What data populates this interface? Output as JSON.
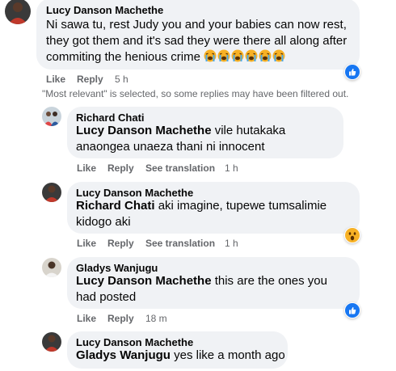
{
  "colors": {
    "bubble": "#f0f2f5",
    "meta_text": "#65676b",
    "like_blue": "#1877f2",
    "wow_yellow": "#f7b125"
  },
  "comments": [
    {
      "author": "Lucy Danson Machethe",
      "text": "Ni sawa tu, rest Judy you and your babies can now rest, they got them and it's sad they were there all along after commiting the henious crime",
      "emoji": [
        "loudly-crying-face-emoji",
        "loudly-crying-face-emoji",
        "loudly-crying-face-emoji",
        "loudly-crying-face-emoji",
        "loudly-crying-face-emoji",
        "loudly-crying-face-emoji"
      ],
      "like": "Like",
      "reply": "Reply",
      "time": "5 h",
      "reaction": "like-reaction-icon"
    },
    {
      "author": "Richard Chati",
      "mention": "Lucy Danson Machethe",
      "text": "vile hutakaka anaongea unaeza thani ni innocent",
      "like": "Like",
      "reply": "Reply",
      "translate": "See translation",
      "time": "1 h"
    },
    {
      "author": "Lucy Danson Machethe",
      "mention": "Richard Chati",
      "text": "aki imagine, tupewe tumsalimie kidogo aki",
      "like": "Like",
      "reply": "Reply",
      "translate": "See translation",
      "time": "1 h",
      "reaction": "wow-reaction-icon"
    },
    {
      "author": "Gladys Wanjugu",
      "mention": "Lucy Danson Machethe",
      "text": "this are the ones you had posted",
      "like": "Like",
      "reply": "Reply",
      "time": "18 m",
      "reaction": "like-reaction-icon"
    },
    {
      "author": "Lucy Danson Machethe",
      "mention": "Gladys Wanjugu",
      "text": "yes like a month ago"
    }
  ],
  "filter_note": "\"Most relevant\" is selected, so some replies may have been filtered out."
}
